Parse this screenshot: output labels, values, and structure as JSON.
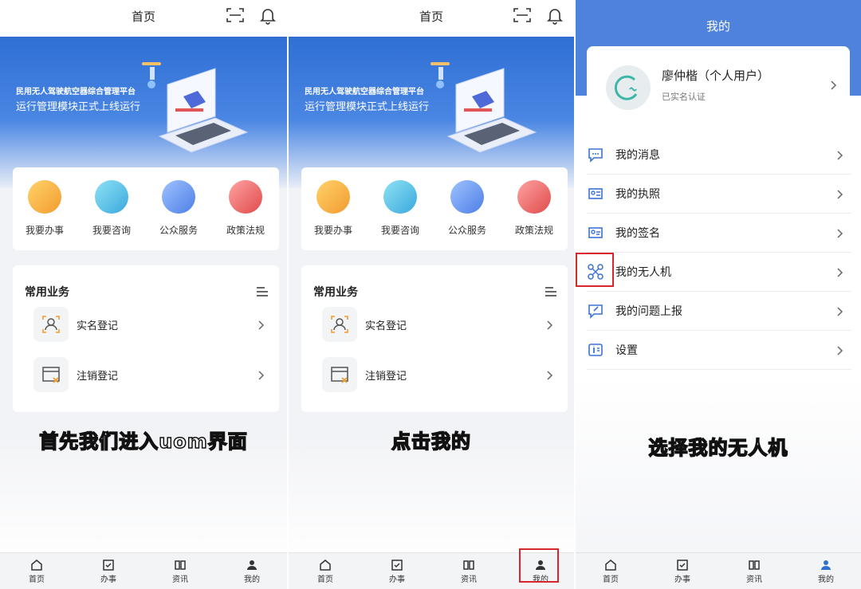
{
  "screen1": {
    "title": "首页",
    "banner": {
      "subtitle": "民用无人驾驶航空器综合管理平台",
      "headline": "运行管理模块正式上线运行"
    },
    "quick": [
      "我要办事",
      "我要咨询",
      "公众服务",
      "政策法规"
    ],
    "common": {
      "title": "常用业务",
      "items": [
        "实名登记",
        "注销登记"
      ]
    },
    "caption": "首先我们进入uom界面",
    "tabs": [
      "首页",
      "办事",
      "资讯",
      "我的"
    ]
  },
  "screen2": {
    "title": "首页",
    "banner": {
      "subtitle": "民用无人驾驶航空器综合管理平台",
      "headline": "运行管理模块正式上线运行"
    },
    "quick": [
      "我要办事",
      "我要咨询",
      "公众服务",
      "政策法规"
    ],
    "common": {
      "title": "常用业务",
      "items": [
        "实名登记",
        "注销登记"
      ]
    },
    "caption": "点击我的",
    "tabs": [
      "首页",
      "办事",
      "资讯",
      "我的"
    ]
  },
  "screen3": {
    "title": "我的",
    "user": {
      "name": "廖仲楷（个人用户）",
      "status": "已实名认证"
    },
    "menu": [
      "我的消息",
      "我的执照",
      "我的签名",
      "我的无人机",
      "我的问题上报",
      "设置"
    ],
    "caption": "选择我的无人机",
    "tabs": [
      "首页",
      "办事",
      "资讯",
      "我的"
    ]
  },
  "colors": {
    "brand_blue": "#4e82dc",
    "highlight_red": "#d8262d",
    "banner_blue": "#2f6fd4"
  }
}
